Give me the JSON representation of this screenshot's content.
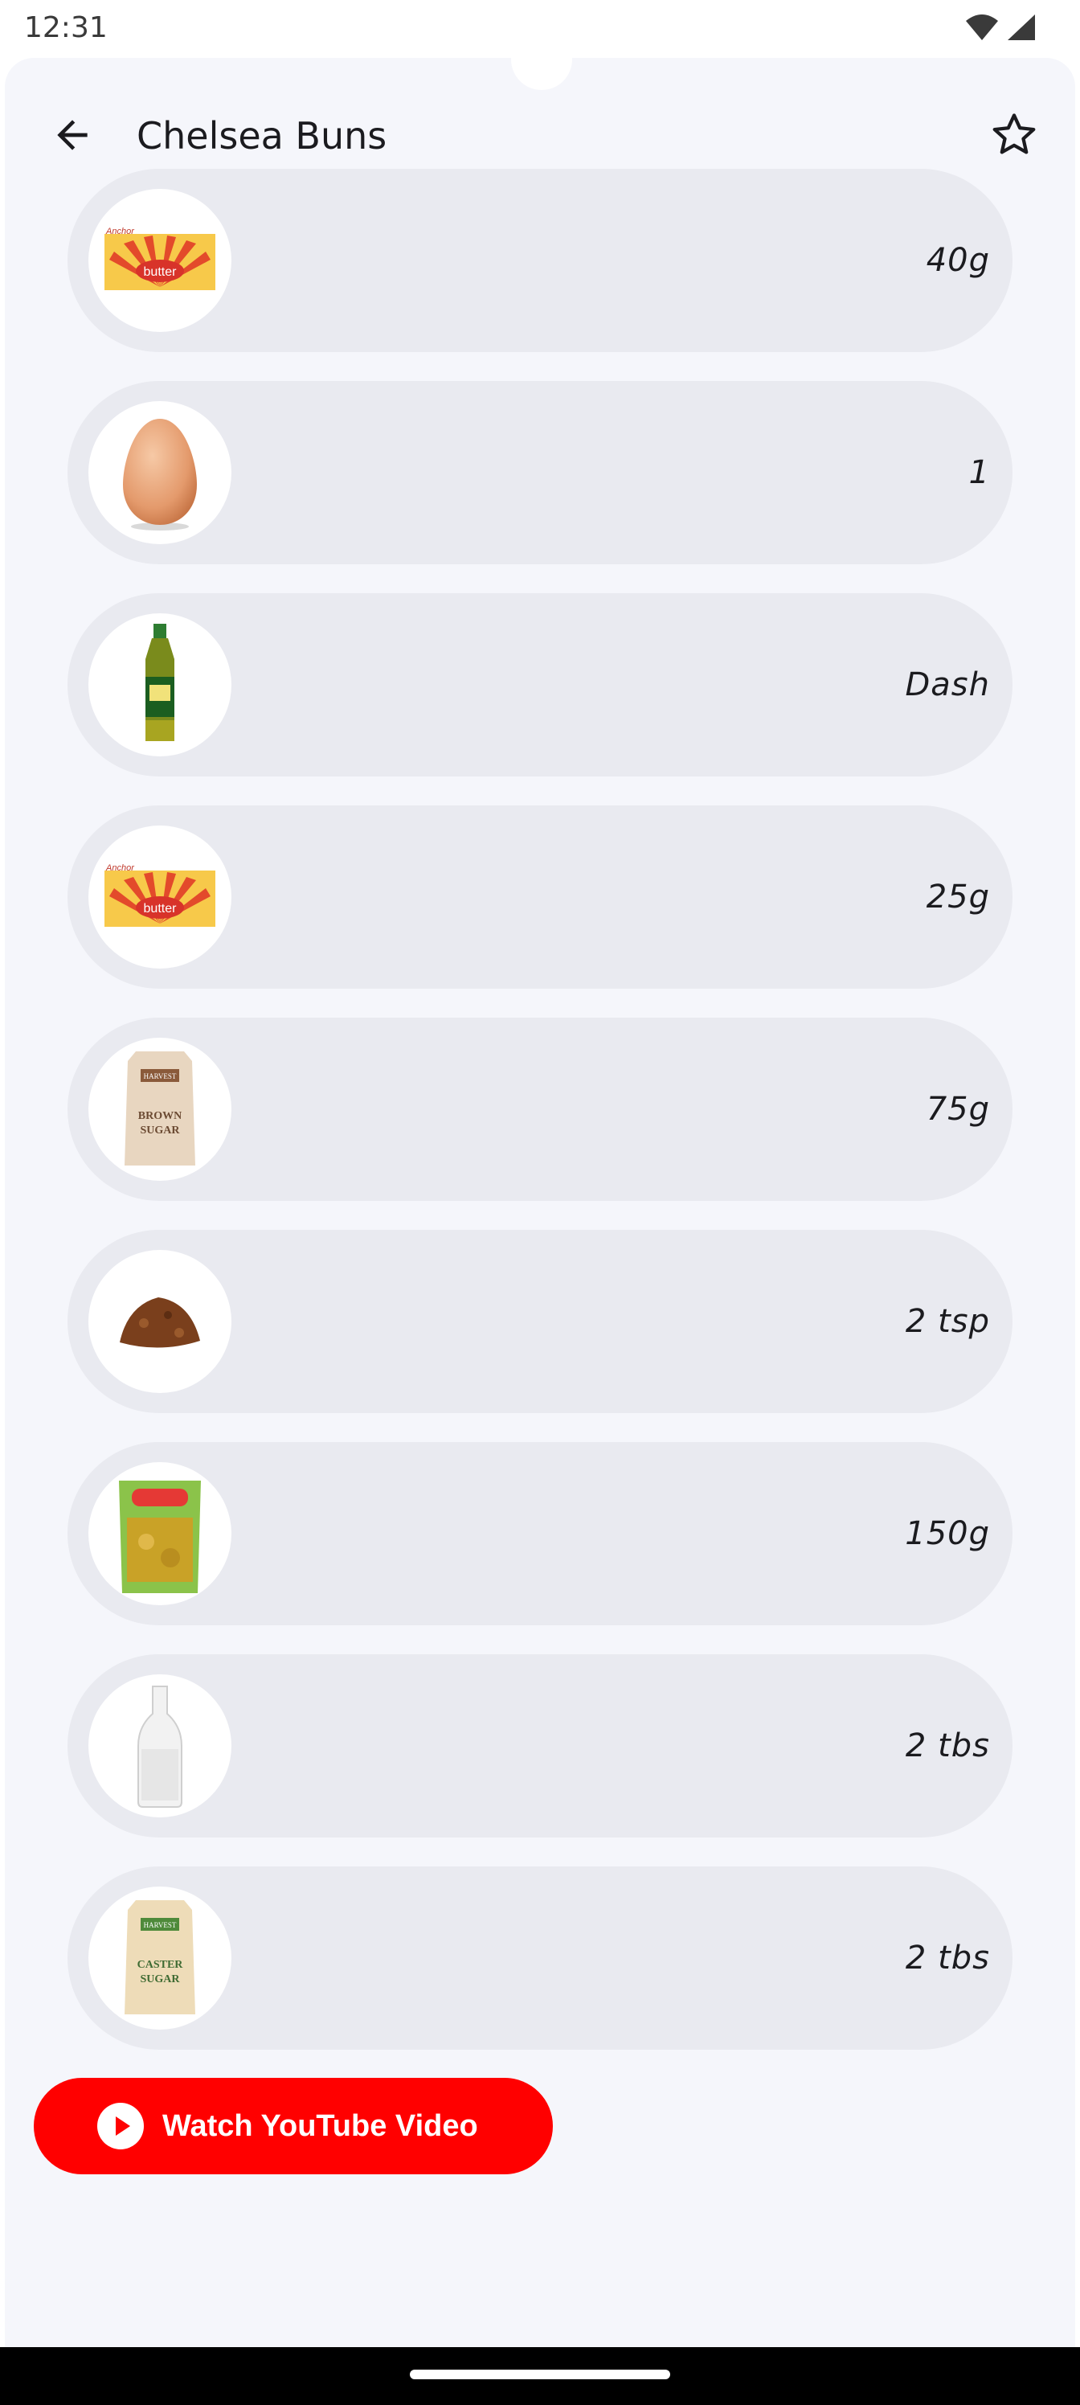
{
  "status_bar": {
    "time": "12:31"
  },
  "app_bar": {
    "title": "Chelsea Buns"
  },
  "ingredients": [
    {
      "amount": "40g",
      "icon": "butter-icon"
    },
    {
      "amount": "1",
      "icon": "egg-icon"
    },
    {
      "amount": "Dash",
      "icon": "olive-oil-icon"
    },
    {
      "amount": "25g",
      "icon": "butter-icon"
    },
    {
      "amount": "75g",
      "icon": "brown-sugar-icon"
    },
    {
      "amount": "2 tsp",
      "icon": "spice-powder-icon"
    },
    {
      "amount": "150g",
      "icon": "dried-fruit-icon"
    },
    {
      "amount": "2 tbs",
      "icon": "milk-bottle-icon"
    },
    {
      "amount": "2 tbs",
      "icon": "caster-sugar-icon"
    }
  ],
  "youtube_button": {
    "label": "Watch YouTube Video"
  },
  "colors": {
    "background": "#f5f6fb",
    "row": "#e9eaf0",
    "youtube_red": "#ff0000"
  }
}
